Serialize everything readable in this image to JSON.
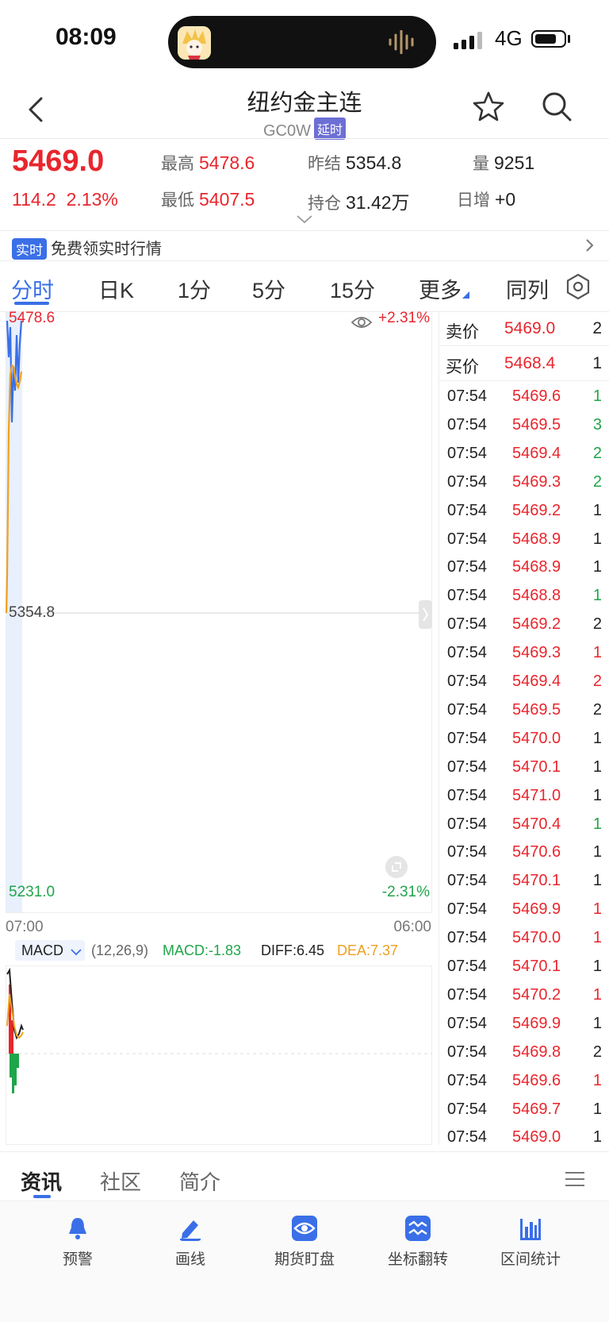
{
  "status_bar": {
    "time": "08:09",
    "network": "4G"
  },
  "header": {
    "title": "纽约金主连",
    "code": "GC0W",
    "delay_badge": "延时"
  },
  "quote": {
    "last_price": "5469.0",
    "change": "114.2",
    "change_pct": "2.13%",
    "stats": [
      {
        "label": "最高",
        "value": "5478.6"
      },
      {
        "label": "昨结",
        "value": "5354.8"
      },
      {
        "label": "量",
        "value": "9251"
      },
      {
        "label": "最低",
        "value": "5407.5"
      },
      {
        "label": "持仓",
        "value": "31.42万"
      },
      {
        "label": "日增",
        "value": "+0"
      }
    ]
  },
  "banner": {
    "tag": "实时",
    "text": "免费领实时行情"
  },
  "tabs": [
    "分时",
    "日K",
    "1分",
    "5分",
    "15分",
    "更多",
    "同列"
  ],
  "chart": {
    "price_high": "5478.6",
    "price_mid": "5354.8",
    "price_low": "5231.0",
    "pct_high": "+2.31%",
    "pct_low": "-2.31%",
    "time_start": "07:00",
    "time_end": "06:00",
    "macd_label": "MACD",
    "macd_params": "(12,26,9)",
    "macd_value": "MACD:-1.83",
    "diff_value": "DIFF:6.45",
    "dea_value": "DEA:7.37",
    "colors": {
      "price_line": "#3a6fe8",
      "avg_line": "#f0a020",
      "up": "#e8262d",
      "down": "#1fa54a"
    }
  },
  "order_book": [
    {
      "label": "卖价",
      "price": "5469.0",
      "volume": "2"
    },
    {
      "label": "买价",
      "price": "5468.4",
      "volume": "1"
    }
  ],
  "trades": [
    {
      "time": "07:54",
      "price": "5469.6",
      "vol": "1",
      "dir": "down"
    },
    {
      "time": "07:54",
      "price": "5469.5",
      "vol": "3",
      "dir": "down"
    },
    {
      "time": "07:54",
      "price": "5469.4",
      "vol": "2",
      "dir": "down"
    },
    {
      "time": "07:54",
      "price": "5469.3",
      "vol": "2",
      "dir": "down"
    },
    {
      "time": "07:54",
      "price": "5469.2",
      "vol": "1",
      "dir": "flat"
    },
    {
      "time": "07:54",
      "price": "5468.9",
      "vol": "1",
      "dir": "flat"
    },
    {
      "time": "07:54",
      "price": "5468.9",
      "vol": "1",
      "dir": "flat"
    },
    {
      "time": "07:54",
      "price": "5468.8",
      "vol": "1",
      "dir": "down"
    },
    {
      "time": "07:54",
      "price": "5469.2",
      "vol": "2",
      "dir": "flat"
    },
    {
      "time": "07:54",
      "price": "5469.3",
      "vol": "1",
      "dir": "up"
    },
    {
      "time": "07:54",
      "price": "5469.4",
      "vol": "2",
      "dir": "up"
    },
    {
      "time": "07:54",
      "price": "5469.5",
      "vol": "2",
      "dir": "flat"
    },
    {
      "time": "07:54",
      "price": "5470.0",
      "vol": "1",
      "dir": "flat"
    },
    {
      "time": "07:54",
      "price": "5470.1",
      "vol": "1",
      "dir": "flat"
    },
    {
      "time": "07:54",
      "price": "5471.0",
      "vol": "1",
      "dir": "flat"
    },
    {
      "time": "07:54",
      "price": "5470.4",
      "vol": "1",
      "dir": "down"
    },
    {
      "time": "07:54",
      "price": "5470.6",
      "vol": "1",
      "dir": "flat"
    },
    {
      "time": "07:54",
      "price": "5470.1",
      "vol": "1",
      "dir": "flat"
    },
    {
      "time": "07:54",
      "price": "5469.9",
      "vol": "1",
      "dir": "up"
    },
    {
      "time": "07:54",
      "price": "5470.0",
      "vol": "1",
      "dir": "up"
    },
    {
      "time": "07:54",
      "price": "5470.1",
      "vol": "1",
      "dir": "flat"
    },
    {
      "time": "07:54",
      "price": "5470.2",
      "vol": "1",
      "dir": "up"
    },
    {
      "time": "07:54",
      "price": "5469.9",
      "vol": "1",
      "dir": "flat"
    },
    {
      "time": "07:54",
      "price": "5469.8",
      "vol": "2",
      "dir": "flat"
    },
    {
      "time": "07:54",
      "price": "5469.6",
      "vol": "1",
      "dir": "up"
    },
    {
      "time": "07:54",
      "price": "5469.7",
      "vol": "1",
      "dir": "flat"
    },
    {
      "time": "07:54",
      "price": "5469.0",
      "vol": "1",
      "dir": "flat"
    }
  ],
  "bottom_tabs": [
    "资讯",
    "社区",
    "简介"
  ],
  "toolbar": [
    {
      "label": "预警",
      "icon": "bell-icon"
    },
    {
      "label": "画线",
      "icon": "pen-icon"
    },
    {
      "label": "期货盯盘",
      "icon": "eye-icon"
    },
    {
      "label": "坐标翻转",
      "icon": "flip-icon"
    },
    {
      "label": "区间统计",
      "icon": "bar-stats-icon"
    }
  ]
}
